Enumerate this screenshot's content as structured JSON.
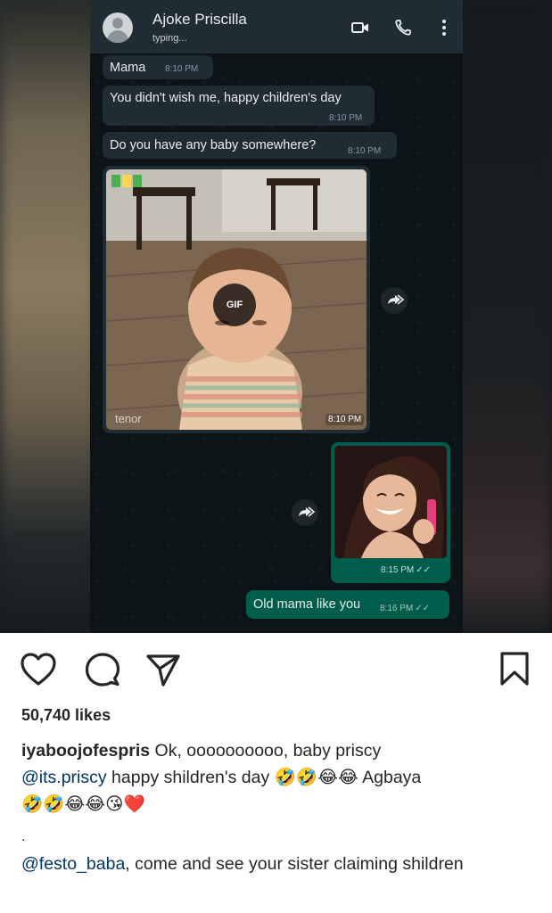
{
  "chat": {
    "contact_name": "Ajoke Priscilla",
    "contact_status": "typing...",
    "messages": [
      {
        "text": "Mama",
        "time": "8:10 PM"
      },
      {
        "text": "You didn't wish me, happy children's day",
        "time": "8:10 PM"
      },
      {
        "text": "Do you have any baby somewhere?",
        "time": "8:10 PM"
      }
    ],
    "gif": {
      "badge": "GIF",
      "source": "tenor",
      "time": "8:10 PM"
    },
    "photo": {
      "time": "8:15 PM"
    },
    "reply": {
      "text": "Old mama like you",
      "time": "8:16 PM"
    },
    "icons": [
      "person-icon",
      "video-call-icon",
      "phone-icon",
      "more-vert-icon",
      "forward-icon"
    ],
    "colors": {
      "bg": "#0d1418",
      "header": "#1f2c33",
      "incoming": "#1f2c33",
      "outgoing": "#005c4b"
    }
  },
  "post": {
    "likes": "50,740 likes",
    "caption": {
      "username": "iyaboojofespris",
      "text_1": " Ok, oooooooooo, baby priscy",
      "mention": "@its.priscy",
      "text_2": " happy shildren's day ",
      "emoji_1": "🤣🤣😂😂",
      "text_3": " Agbaya",
      "emoji_2": "🤣🤣😂😂😘❤️"
    },
    "separator": ".",
    "comment": {
      "mention": "@festo_baba",
      "text": ", come and see your sister claiming shildren"
    },
    "icons": [
      "heart-icon",
      "comment-icon",
      "share-icon",
      "bookmark-icon"
    ]
  }
}
